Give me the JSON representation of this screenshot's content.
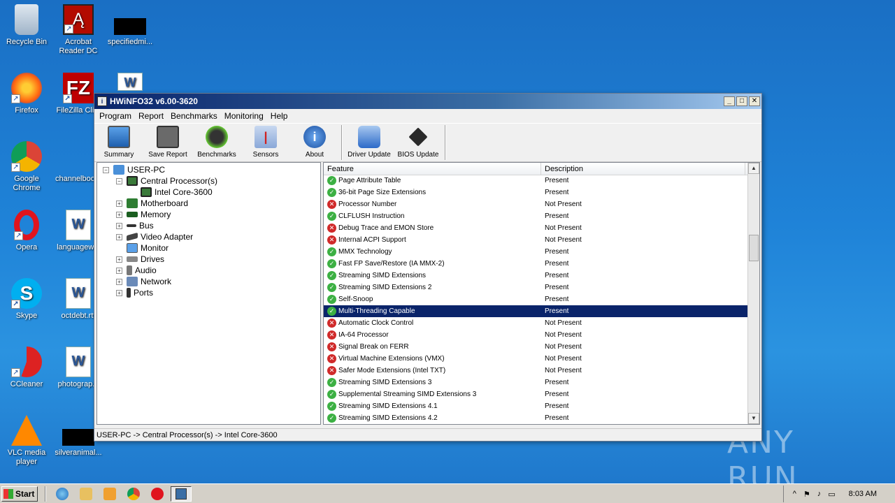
{
  "desktop": {
    "icons": [
      {
        "label": "Recycle Bin",
        "icon": "recycle-bin-icon"
      },
      {
        "label": "Acrobat Reader DC",
        "icon": "acrobat-icon"
      },
      {
        "label": "specifiedmi...",
        "icon": "file-icon"
      },
      {
        "label": "Firefox",
        "icon": "firefox-icon"
      },
      {
        "label": "FileZilla Cli...",
        "icon": "filezilla-icon"
      },
      {
        "label": "",
        "icon": "word-doc-icon"
      },
      {
        "label": "Google Chrome",
        "icon": "chrome-icon"
      },
      {
        "label": "channelboo...",
        "icon": "file-icon"
      },
      {
        "label": "Opera",
        "icon": "opera-icon"
      },
      {
        "label": "languagew...",
        "icon": "word-doc-icon"
      },
      {
        "label": "Skype",
        "icon": "skype-icon"
      },
      {
        "label": "octdebt.rtf",
        "icon": "word-doc-icon"
      },
      {
        "label": "CCleaner",
        "icon": "ccleaner-icon"
      },
      {
        "label": "photograp...",
        "icon": "word-doc-icon"
      },
      {
        "label": "VLC media player",
        "icon": "vlc-icon"
      },
      {
        "label": "silveranimal...",
        "icon": "file-icon"
      }
    ],
    "watermark": "ANY RUN"
  },
  "window": {
    "title": "HWiNFO32 v6.00-3620",
    "menu": [
      "Program",
      "Report",
      "Benchmarks",
      "Monitoring",
      "Help"
    ],
    "toolbar": [
      {
        "label": "Summary",
        "icon": "monitor-icon"
      },
      {
        "label": "Save Report",
        "icon": "floppy-icon"
      },
      {
        "label": "Benchmarks",
        "icon": "gauge-icon"
      },
      {
        "label": "Sensors",
        "icon": "thermometer-icon"
      },
      {
        "label": "About",
        "icon": "info-icon"
      },
      {
        "label": "Driver Update",
        "icon": "driver-update-icon"
      },
      {
        "label": "BIOS Update",
        "icon": "chip-icon"
      }
    ],
    "tree": [
      {
        "label": "USER-PC",
        "expander": "−",
        "level": 0
      },
      {
        "label": "Central Processor(s)",
        "expander": "−",
        "level": 1
      },
      {
        "label": "Intel Core-3600",
        "expander": "",
        "level": 2
      },
      {
        "label": "Motherboard",
        "expander": "+",
        "level": 1
      },
      {
        "label": "Memory",
        "expander": "+",
        "level": 1
      },
      {
        "label": "Bus",
        "expander": "+",
        "level": 1
      },
      {
        "label": "Video Adapter",
        "expander": "+",
        "level": 1
      },
      {
        "label": "Monitor",
        "expander": "",
        "level": 1
      },
      {
        "label": "Drives",
        "expander": "+",
        "level": 1
      },
      {
        "label": "Audio",
        "expander": "+",
        "level": 1
      },
      {
        "label": "Network",
        "expander": "+",
        "level": 1
      },
      {
        "label": "Ports",
        "expander": "+",
        "level": 1
      }
    ],
    "columns": {
      "feature": "Feature",
      "description": "Description"
    },
    "rows": [
      {
        "feature": "Page Attribute Table",
        "description": "Present",
        "ok": true
      },
      {
        "feature": "36-bit Page Size Extensions",
        "description": "Present",
        "ok": true
      },
      {
        "feature": "Processor Number",
        "description": "Not Present",
        "ok": false
      },
      {
        "feature": "CLFLUSH Instruction",
        "description": "Present",
        "ok": true
      },
      {
        "feature": "Debug Trace and EMON Store",
        "description": "Not Present",
        "ok": false
      },
      {
        "feature": "Internal ACPI Support",
        "description": "Not Present",
        "ok": false
      },
      {
        "feature": "MMX Technology",
        "description": "Present",
        "ok": true
      },
      {
        "feature": "Fast FP Save/Restore (IA MMX-2)",
        "description": "Present",
        "ok": true
      },
      {
        "feature": "Streaming SIMD Extensions",
        "description": "Present",
        "ok": true
      },
      {
        "feature": "Streaming SIMD Extensions 2",
        "description": "Present",
        "ok": true
      },
      {
        "feature": "Self-Snoop",
        "description": "Present",
        "ok": true
      },
      {
        "feature": "Multi-Threading Capable",
        "description": "Present",
        "ok": true,
        "selected": true
      },
      {
        "feature": "Automatic Clock Control",
        "description": "Not Present",
        "ok": false
      },
      {
        "feature": "IA-64 Processor",
        "description": "Not Present",
        "ok": false
      },
      {
        "feature": "Signal Break on FERR",
        "description": "Not Present",
        "ok": false
      },
      {
        "feature": "Virtual Machine Extensions (VMX)",
        "description": "Not Present",
        "ok": false
      },
      {
        "feature": "Safer Mode Extensions (Intel TXT)",
        "description": "Not Present",
        "ok": false
      },
      {
        "feature": "Streaming SIMD Extensions 3",
        "description": "Present",
        "ok": true
      },
      {
        "feature": "Supplemental Streaming SIMD Extensions 3",
        "description": "Present",
        "ok": true
      },
      {
        "feature": "Streaming SIMD Extensions 4.1",
        "description": "Present",
        "ok": true
      },
      {
        "feature": "Streaming SIMD Extensions 4.2",
        "description": "Present",
        "ok": true
      }
    ],
    "status": "USER-PC -> Central Processor(s) -> Intel Core-3600"
  },
  "taskbar": {
    "start": "Start",
    "clock": "8:03 AM"
  },
  "colors": {
    "selection": "#0a246a",
    "present": "#3cb043",
    "not_present": "#d02a2a"
  }
}
